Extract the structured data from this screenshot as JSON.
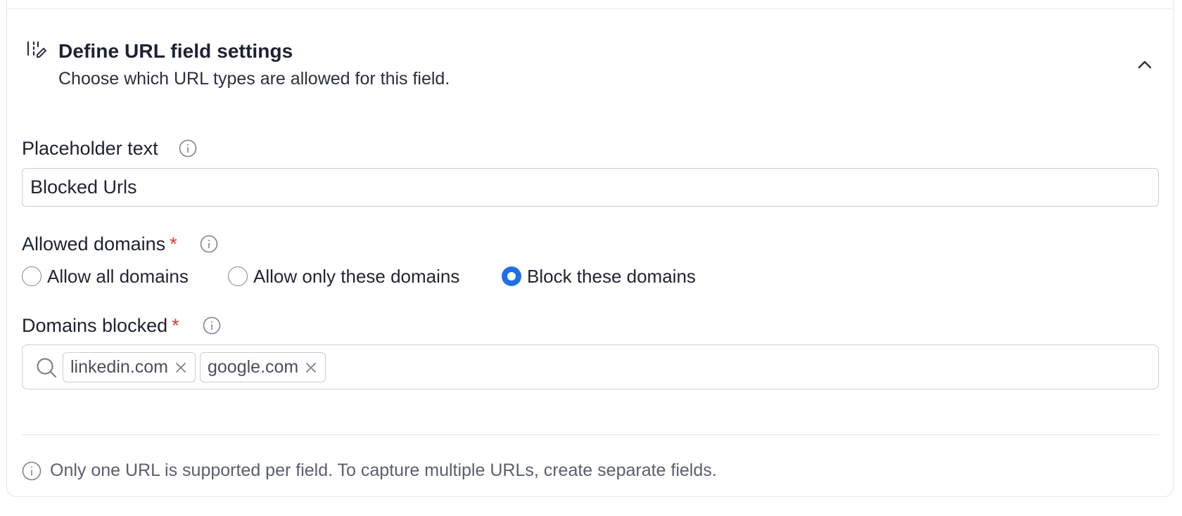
{
  "header": {
    "title": "Define URL field settings",
    "subtitle": "Choose which URL types are allowed for this field.",
    "icon": "field-settings-icon",
    "collapse_icon": "chevron-up-icon"
  },
  "placeholder_section": {
    "label": "Placeholder text",
    "value": "Blocked Urls"
  },
  "allowed_domains": {
    "label": "Allowed domains",
    "required_mark": "*",
    "options": [
      {
        "label": "Allow all domains",
        "selected": false
      },
      {
        "label": "Allow only these domains",
        "selected": false
      },
      {
        "label": "Block these domains",
        "selected": true
      }
    ]
  },
  "domains_blocked": {
    "label": "Domains blocked",
    "required_mark": "*",
    "tags": [
      "linkedin.com",
      "google.com"
    ]
  },
  "footer": {
    "note": "Only one URL is supported per field. To capture multiple URLs, create separate fields."
  },
  "colors": {
    "accent": "#1f6feb",
    "required": "#d13b3b",
    "border": "#c9cdd3"
  }
}
